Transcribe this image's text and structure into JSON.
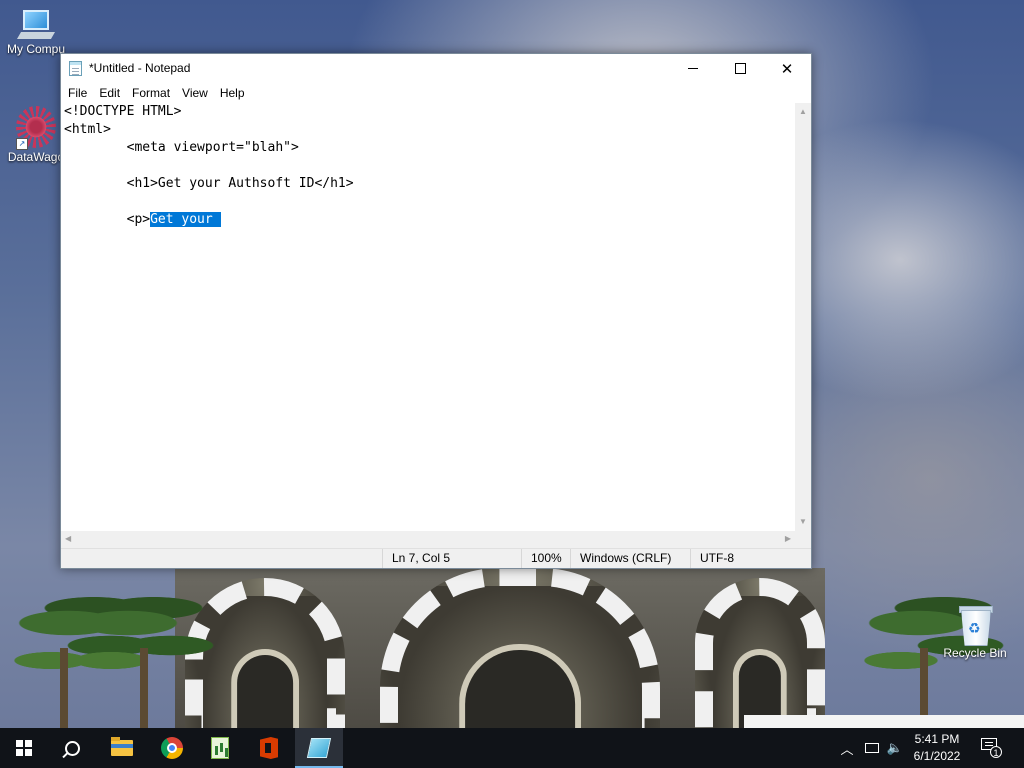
{
  "desktop": {
    "icons": [
      {
        "label": "My Compu"
      },
      {
        "label": "DataWago"
      },
      {
        "label": "Recycle Bin"
      }
    ]
  },
  "notepad": {
    "title": "*Untitled - Notepad",
    "menu": [
      "File",
      "Edit",
      "Format",
      "View",
      "Help"
    ],
    "lines": [
      "<!DOCTYPE HTML>",
      "<html>",
      "        <meta viewport=\"blah\">",
      "",
      "        <h1>Get your Authsoft ID</h1>",
      "",
      "        <p>"
    ],
    "selected_text": "Get your ",
    "status": {
      "position": "Ln 7, Col 5",
      "zoom": "100%",
      "line_ending": "Windows (CRLF)",
      "encoding": "UTF-8"
    }
  },
  "taskbar": {
    "apps": [
      "start-icon",
      "search-icon",
      "file-explorer-icon",
      "chrome-icon",
      "sheet-app-icon",
      "office-icon",
      "notepad-icon"
    ],
    "clock_time": "5:41 PM",
    "clock_date": "6/1/2022",
    "notification_count": "1"
  }
}
